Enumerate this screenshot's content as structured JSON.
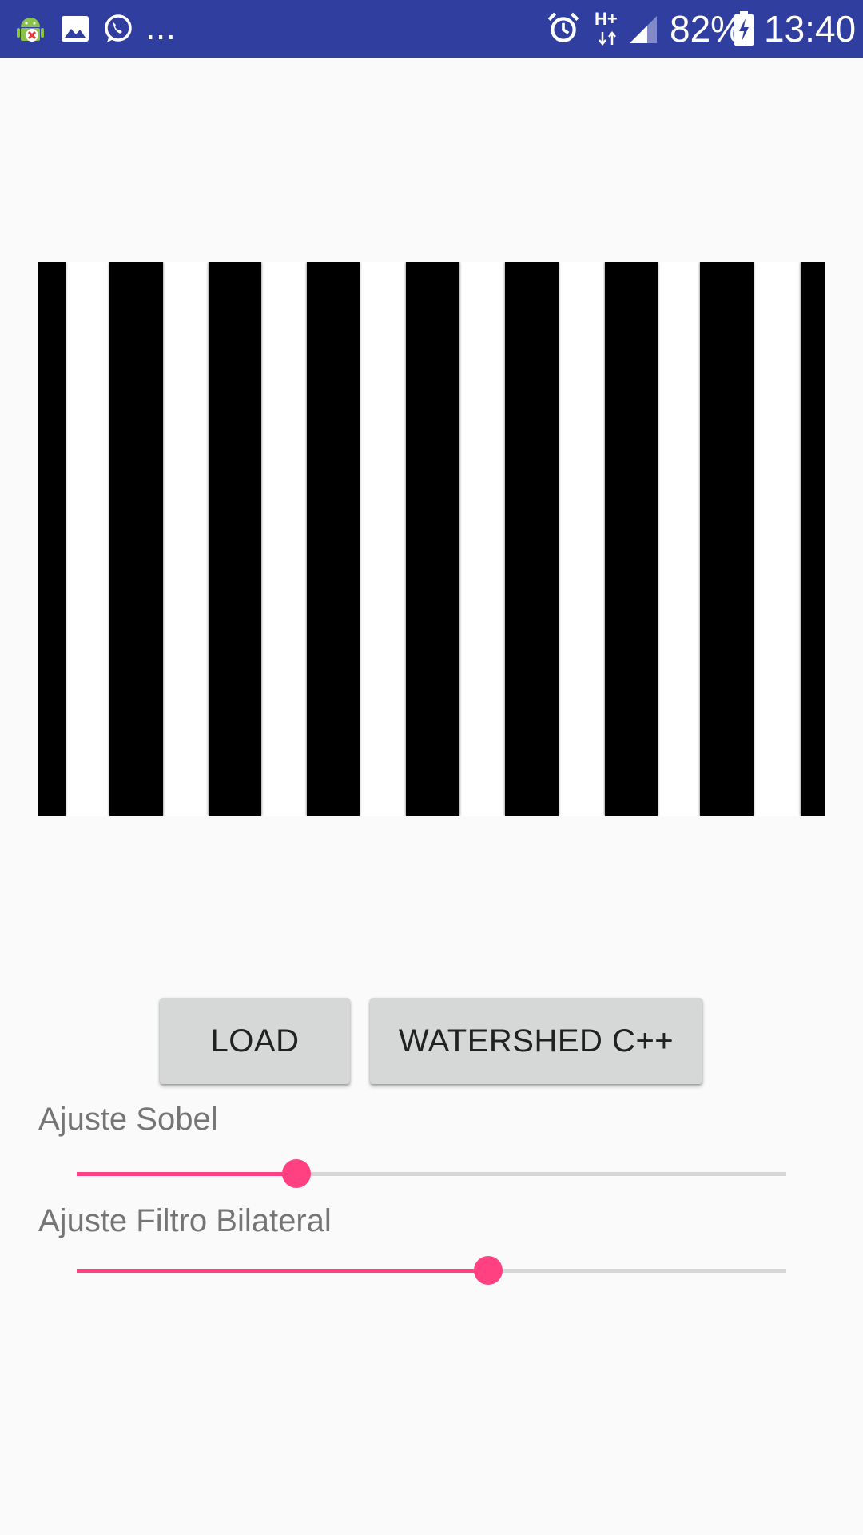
{
  "status_bar": {
    "notification_icons": [
      "android-debug-icon",
      "image-icon",
      "whatsapp-icon"
    ],
    "more_indicator": "...",
    "network": "H+",
    "battery": "82%",
    "time": "13:40",
    "background": "#303f9f"
  },
  "image_view": {
    "content": "black-white-vertical-stripes"
  },
  "buttons": {
    "load_label": "LOAD",
    "watershed_label": "WATERSHED C++"
  },
  "sliders": [
    {
      "label": "Ajuste Sobel",
      "value": 0.31
    },
    {
      "label": "Ajuste Filtro Bilateral",
      "value": 0.58
    }
  ],
  "colors": {
    "accent": "#ff4081",
    "button_bg": "#d6d7d7",
    "label_text": "#757575",
    "background": "#fafafa"
  }
}
